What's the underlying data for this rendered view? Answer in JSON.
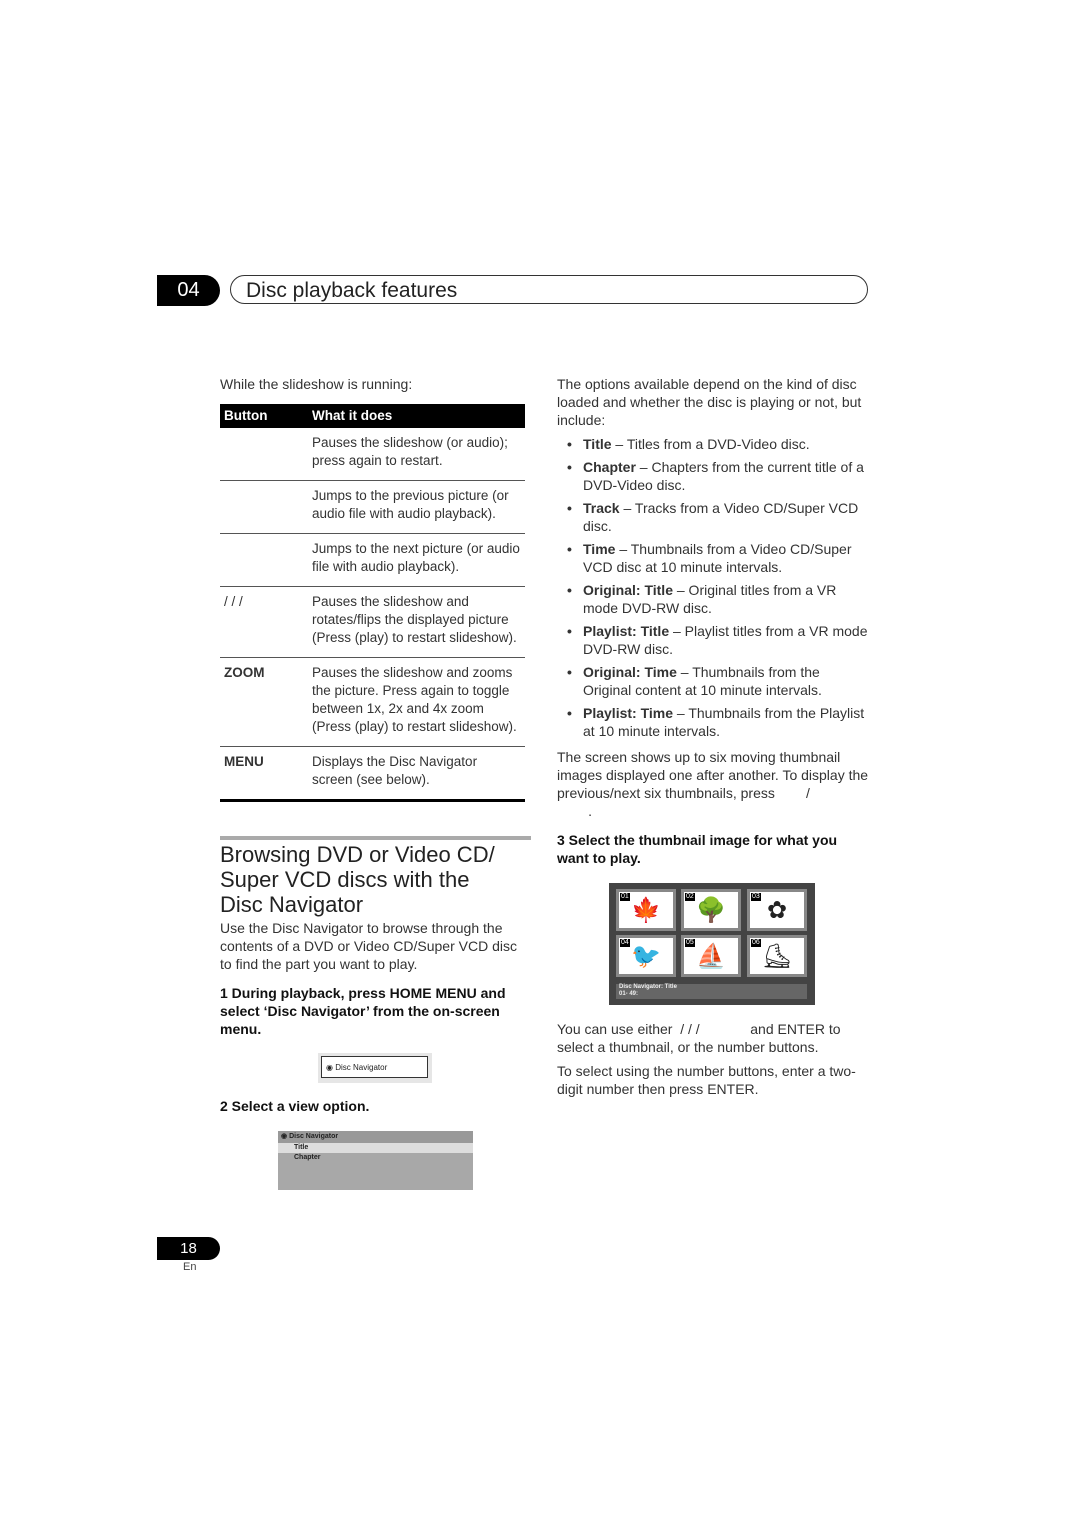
{
  "header": {
    "chapter_number": "04",
    "chapter_title": "Disc playback features"
  },
  "left": {
    "intro": "While the slideshow is running:",
    "table": {
      "headers": [
        "Button",
        "What it does"
      ],
      "rows": [
        {
          "button": "",
          "desc": "Pauses the slideshow (or audio); press again to restart."
        },
        {
          "button": "",
          "desc": "Jumps to the previous picture (or audio file with audio playback)."
        },
        {
          "button": "",
          "desc": "Jumps to the next picture (or audio file with audio playback)."
        },
        {
          "button": "/ / /",
          "desc": "Pauses the slideshow and rotates/flips the displayed picture (Press     (play) to restart slideshow)."
        },
        {
          "button": "ZOOM",
          "desc": "Pauses the slideshow and zooms the picture. Press again to toggle between 1x, 2x and 4x zoom (Press     (play) to restart slideshow)."
        },
        {
          "button": "MENU",
          "desc": "Displays the Disc Navigator screen (see below)."
        }
      ]
    },
    "section_title": "Browsing DVD or Video CD/ Super VCD discs with the Disc Navigator",
    "section_intro": "Use the Disc Navigator to browse through the contents of a DVD or Video CD/Super VCD disc to find the part you want to play.",
    "step1": "1   During playback, press HOME MENU and select ‘Disc Navigator’ from the on-screen menu.",
    "menu_button_label": "Disc Navigator",
    "step2": "2   Select a view option.",
    "view_menu": {
      "title": "Disc Navigator",
      "items": [
        "Title",
        "Chapter"
      ]
    }
  },
  "right": {
    "intro": "The options available depend on the kind of disc loaded and whether the disc is playing or not, but include:",
    "options": [
      {
        "term": "Title",
        "desc": " – Titles from a DVD-Video disc."
      },
      {
        "term": "Chapter",
        "desc": " – Chapters from the current title of a DVD-Video disc."
      },
      {
        "term": "Track",
        "desc": " – Tracks from a Video CD/Super VCD disc."
      },
      {
        "term": "Time",
        "desc": " – Thumbnails from a Video CD/Super VCD disc at 10 minute intervals."
      },
      {
        "term": "Original: Title",
        "desc": " – Original titles from a VR mode DVD-RW disc."
      },
      {
        "term": "Playlist: Title",
        "desc": " – Playlist titles from a VR mode DVD-RW disc."
      },
      {
        "term": "Original: Time",
        "desc": " – Thumbnails from the Original content at 10 minute intervals."
      },
      {
        "term": "Playlist: Time",
        "desc": " – Thumbnails from the Playlist at 10 minute intervals."
      }
    ],
    "screen_text": "The screen shows up to six moving thumbnail images displayed one after another. To display the previous/next six thumbnails, press        /\n        .",
    "step3": "3   Select the thumbnail image for what you want to play.",
    "thumbnails": {
      "numbers": [
        "01",
        "02",
        "03",
        "04",
        "05",
        "06"
      ],
      "caption": "Disc Navigator: Title",
      "range": "01- 49:"
    },
    "use_text": "You can use either  / / /             and ENTER to select a thumbnail, or the number buttons.",
    "number_text": "To select using the number buttons, enter a two-digit number then press ENTER."
  },
  "footer": {
    "page_number": "18",
    "lang": "En"
  }
}
